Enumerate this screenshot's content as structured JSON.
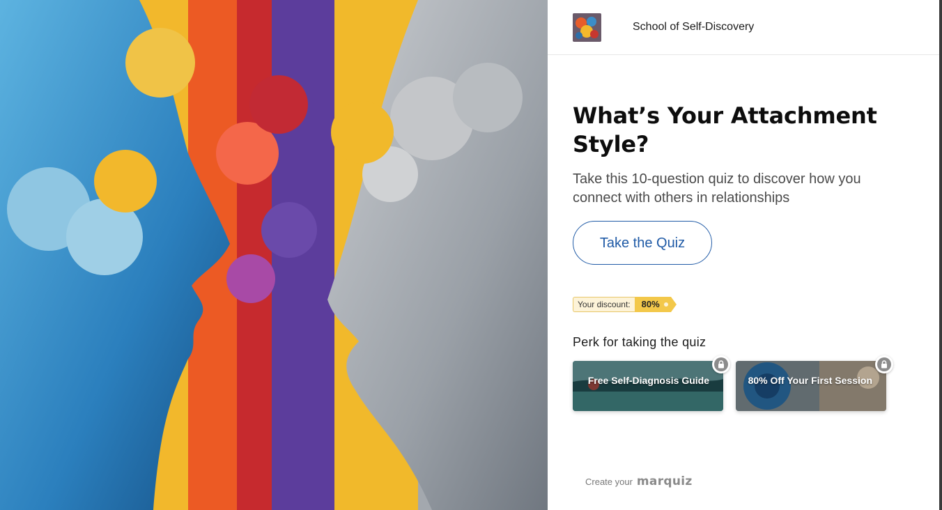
{
  "header": {
    "brand_name": "School of Self-Discovery",
    "logo_icon": "abstract-painting-logo-icon"
  },
  "main": {
    "title": "What’s Your Attachment Style?",
    "subtitle": "Take this 10-question quiz to discover how you connect with others in relationships",
    "cta_label": "Take the Quiz",
    "discount": {
      "label": "Your discount:",
      "value": "80%"
    },
    "perks_heading": "Perk for taking the quiz",
    "perks": [
      {
        "label": "Free Self-Diagnosis Guide",
        "icon": "lock-icon"
      },
      {
        "label": "80% Off Your First Session",
        "icon": "lock-icon"
      }
    ]
  },
  "footer": {
    "create_text": "Create your",
    "brand": "marquiz"
  },
  "colors": {
    "accent": "#1f5aa6",
    "discount_badge": "#f3c84a",
    "title": "#0d0d0d"
  }
}
